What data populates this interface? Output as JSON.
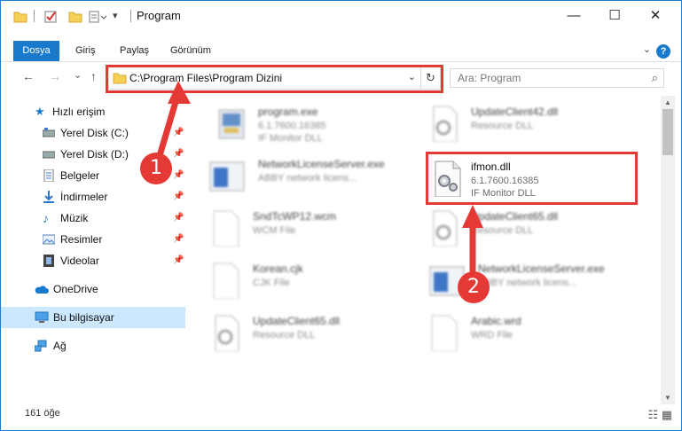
{
  "window": {
    "title": "Program",
    "controls": {
      "minimize": "—",
      "maximize": "☐",
      "close": "✕"
    }
  },
  "ribbon": {
    "tabs": [
      "Dosya",
      "Giriş",
      "Paylaş",
      "Görünüm"
    ],
    "help": "?"
  },
  "nav": {
    "back": "←",
    "forward": "→",
    "recent": "⌄",
    "up": "↑",
    "address": "C:\\Program Files\\Program Dizini",
    "search_placeholder": "Ara: Program"
  },
  "sidebar": {
    "items": [
      {
        "label": "Hızlı erişim",
        "icon": "star-icon",
        "pinned": false
      },
      {
        "label": "Yerel Disk (C:)",
        "icon": "drive-icon",
        "pinned": true
      },
      {
        "label": "Yerel Disk (D:)",
        "icon": "drive-icon",
        "pinned": true
      },
      {
        "label": "Belgeler",
        "icon": "documents-icon",
        "pinned": true
      },
      {
        "label": "İndirmeler",
        "icon": "download-icon",
        "pinned": true
      },
      {
        "label": "Müzik",
        "icon": "music-icon",
        "pinned": true
      },
      {
        "label": "Resimler",
        "icon": "pictures-icon",
        "pinned": true
      },
      {
        "label": "Videolar",
        "icon": "videos-icon",
        "pinned": true
      },
      {
        "label": "OneDrive",
        "icon": "cloud-icon",
        "pinned": false
      },
      {
        "label": "Bu bilgisayar",
        "icon": "computer-icon",
        "pinned": false
      },
      {
        "label": "Ağ",
        "icon": "network-icon",
        "pinned": false
      }
    ]
  },
  "files": [
    {
      "name": "program.exe",
      "line2": "6.1.7600.16385",
      "line3": "IF Monitor DLL",
      "icon": "exe-icon",
      "blurred": true
    },
    {
      "name": "UpdateClient42.dll",
      "line2": "Resource DLL",
      "line3": "",
      "icon": "dll-icon",
      "blurred": true
    },
    {
      "name": "NetworkLicenseServer.exe",
      "line2": "ABBY network licens...",
      "line3": "",
      "icon": "app-icon",
      "blurred": true
    },
    {
      "name": "ifmon.dll",
      "line2": "6.1.7600.16385",
      "line3": "IF Monitor DLL",
      "icon": "gear-dll-icon",
      "blurred": false
    },
    {
      "name": "SndTcWP12.wcm",
      "line2": "WCM File",
      "line3": "",
      "icon": "file-icon",
      "blurred": true
    },
    {
      "name": "UpdateClient65.dll",
      "line2": "Resource DLL",
      "line3": "",
      "icon": "dll-icon",
      "blurred": true
    },
    {
      "name": "Korean.cjk",
      "line2": "CJK File",
      "line3": "",
      "icon": "file-icon",
      "blurred": true
    },
    {
      "name": "NetworkLicenseServer.exe",
      "line2": "ABBY network licens...",
      "line3": "",
      "icon": "app-icon",
      "blurred": true
    },
    {
      "name": "UpdateClient65.dll",
      "line2": "Resource DLL",
      "line3": "",
      "icon": "dll-icon",
      "blurred": true
    },
    {
      "name": "Arabic.wrd",
      "line2": "WRD File",
      "line3": "",
      "icon": "file-icon",
      "blurred": true
    }
  ],
  "status": {
    "count": "161 öğe"
  },
  "annotations": {
    "step1": "1",
    "step2": "2",
    "color": "#e53935"
  }
}
